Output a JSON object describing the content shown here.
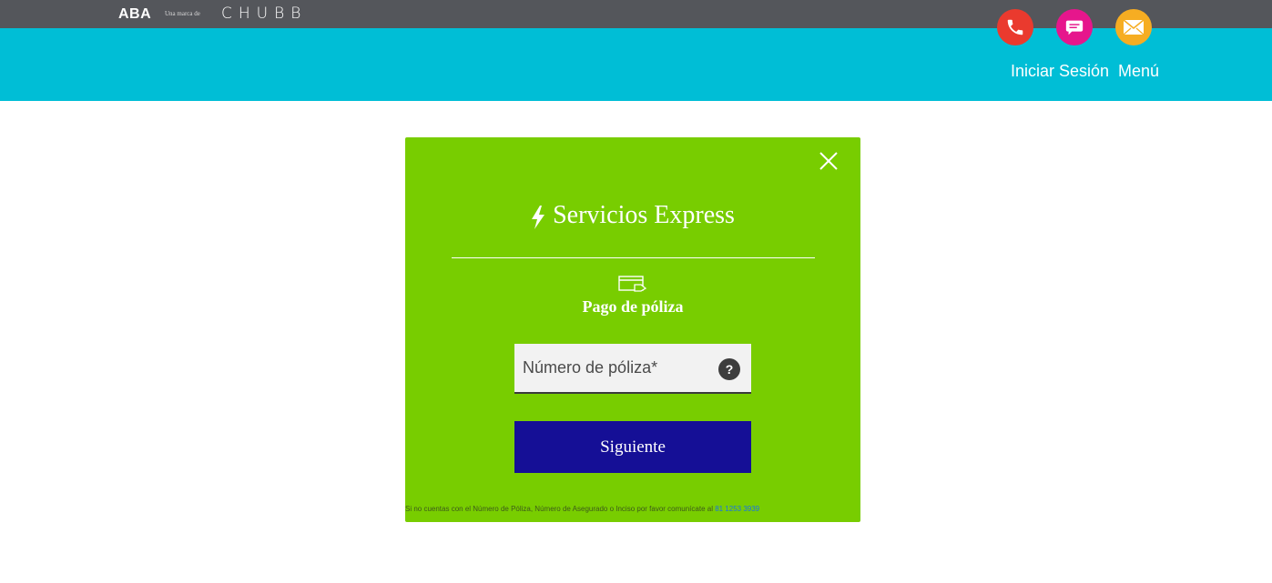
{
  "topbar": {
    "brand_primary": "ABA",
    "brand_tagline": "Una marca de",
    "brand_secondary": "CHUBB"
  },
  "header": {
    "icons": [
      "phone-icon",
      "chat-icon",
      "mail-icon"
    ],
    "colors": {
      "phone": "#ea3a2e",
      "chat": "#e6168c",
      "mail": "#f6ad22",
      "header_bg": "#00bed6",
      "topbar_bg": "#54565b"
    },
    "login_label": "Iniciar Sesión",
    "menu_label": "Menú"
  },
  "modal": {
    "bg_color": "#78cd00",
    "title": "Servicios Express",
    "subtitle": "Pago de póliza",
    "input_placeholder": "Número de póliza*",
    "help_label": "?",
    "button_label": "Siguiente",
    "button_color": "#150f96",
    "footnote_text": "Si no cuentas con el Número de Póliza, Número de Asegurado o Inciso por favor comunícate al ",
    "footnote_phone": "81 1253 3939"
  }
}
